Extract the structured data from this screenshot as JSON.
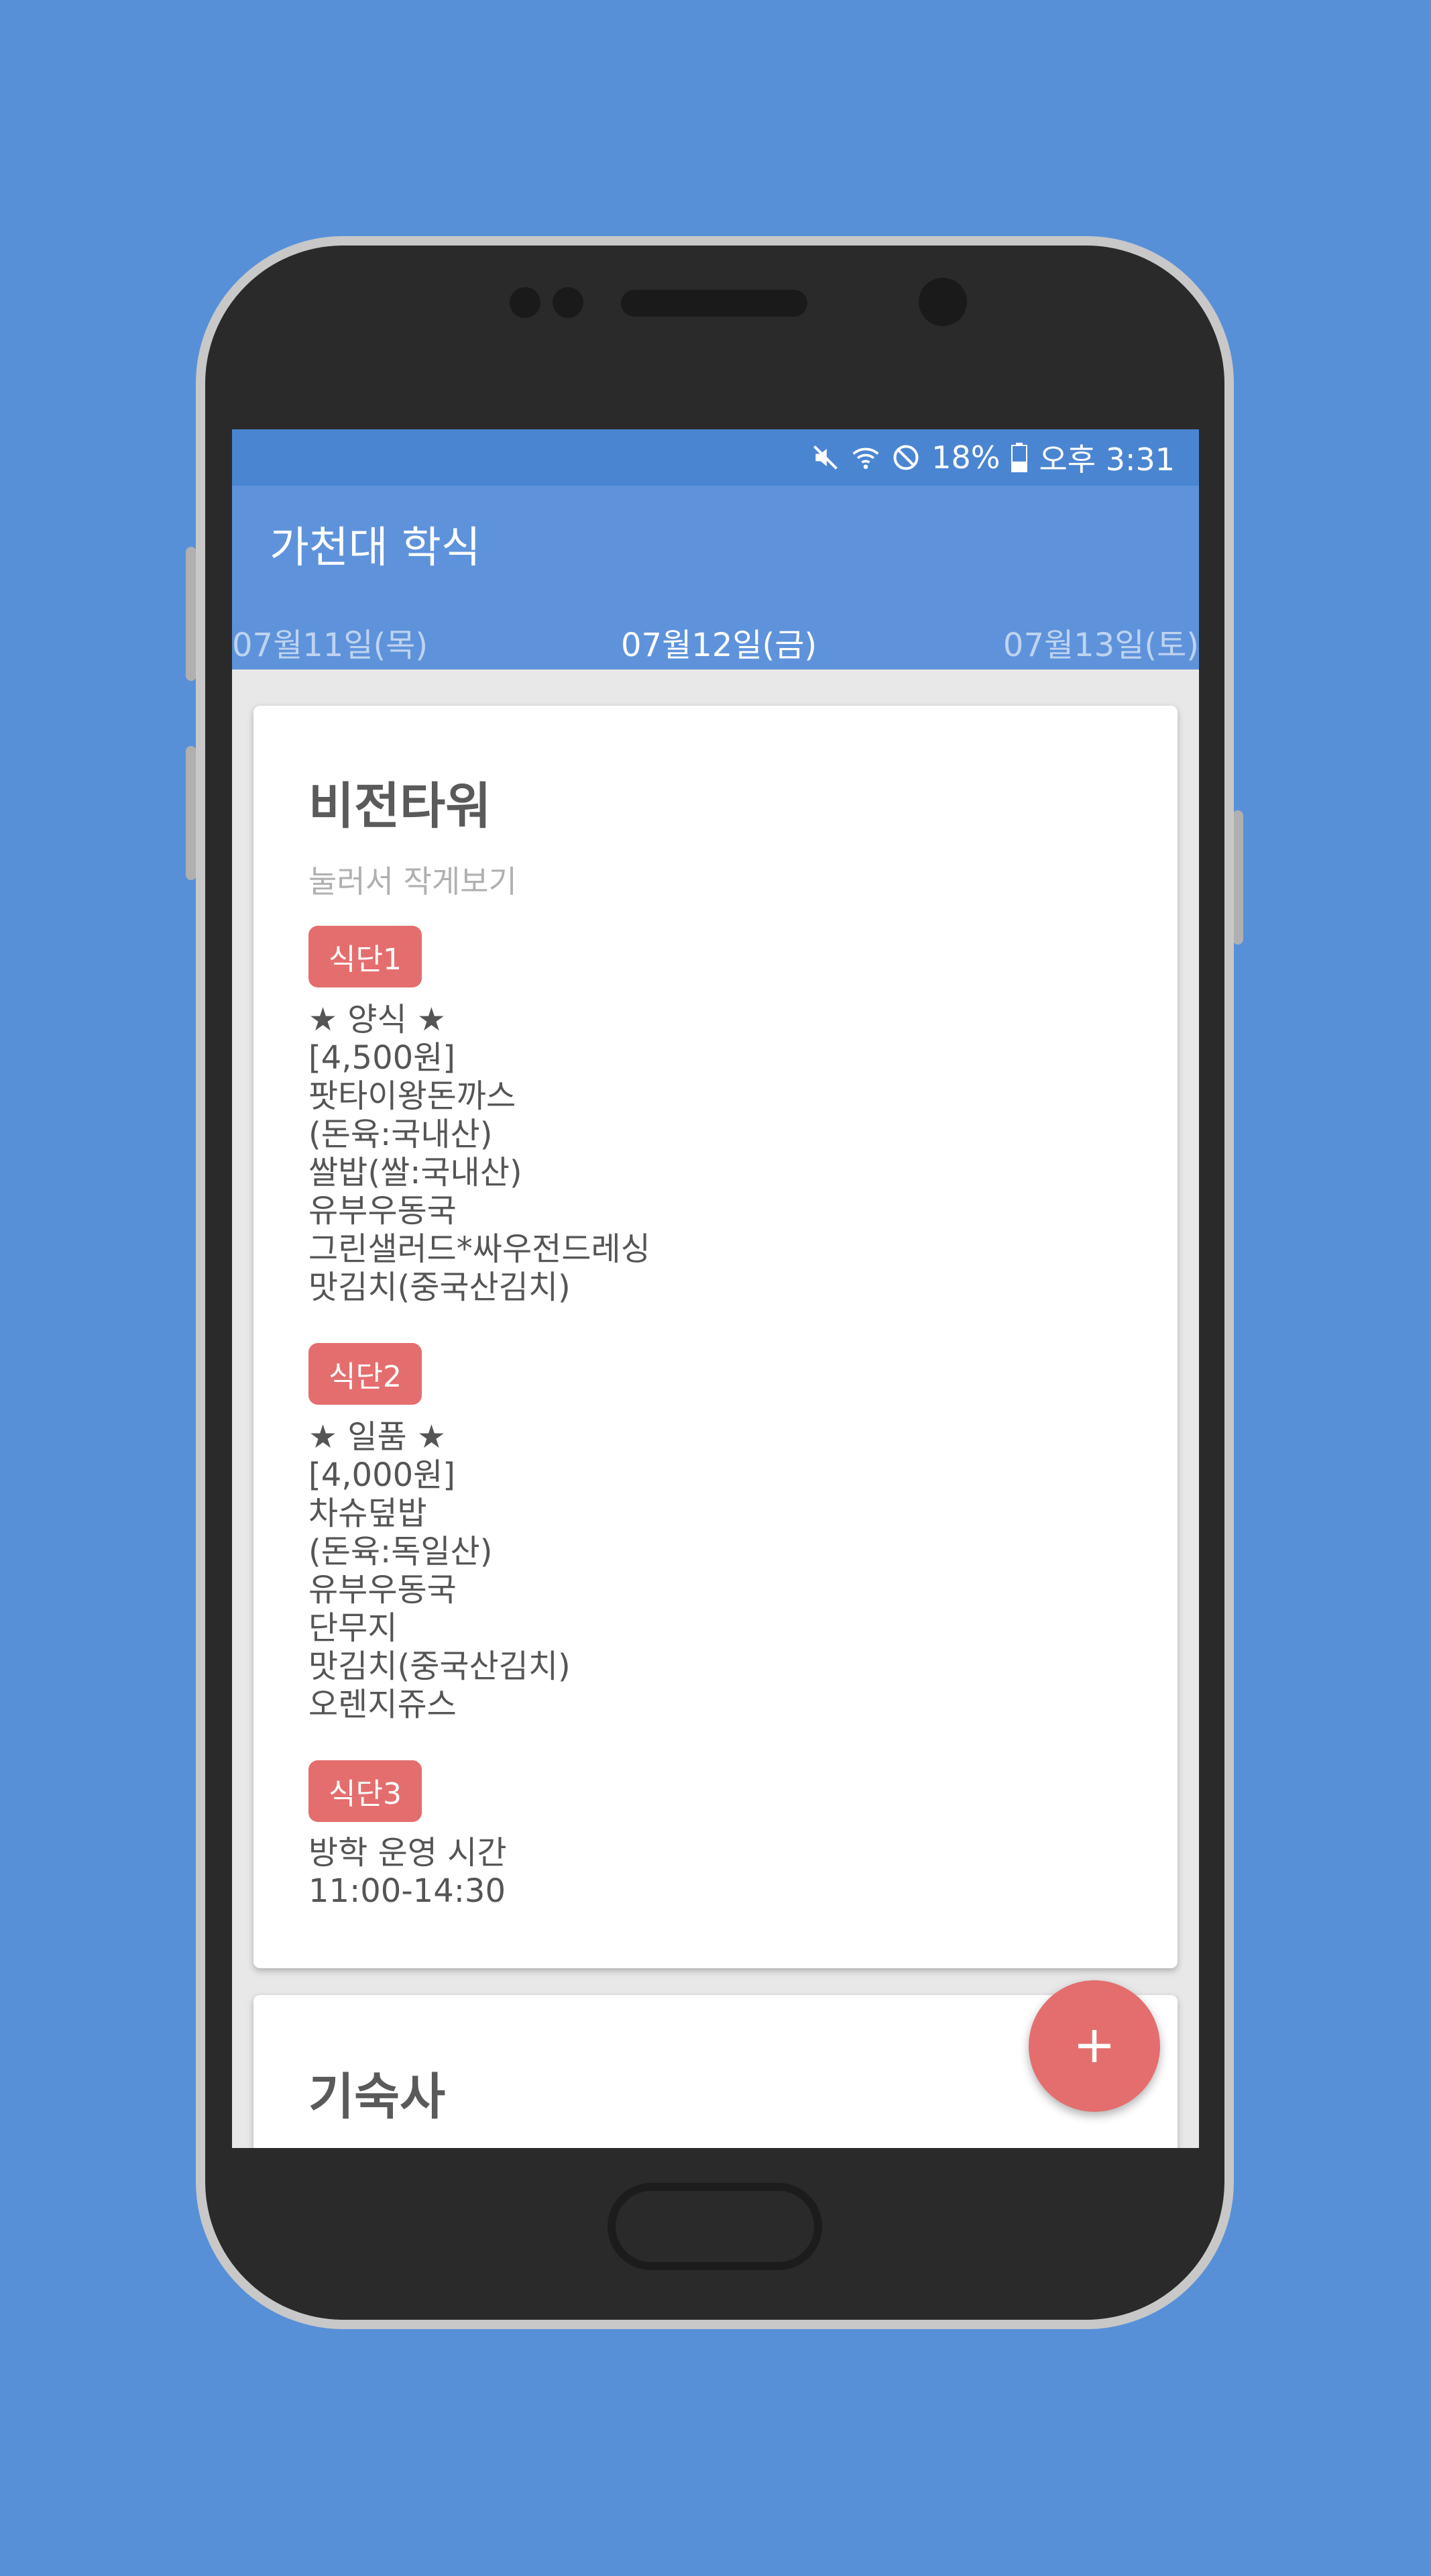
{
  "status": {
    "battery_pct": "18%",
    "time": "오후 3:31",
    "icons": [
      "mute-icon",
      "wifi-icon",
      "do-not-disturb-icon",
      "battery-icon"
    ]
  },
  "app": {
    "title": "가천대 학식"
  },
  "dates": {
    "prev": "07월11일(목)",
    "current": "07월12일(금)",
    "next": "07월13일(토)"
  },
  "cards": [
    {
      "title": "비전타워",
      "hint": "눌러서 작게보기",
      "menus": [
        {
          "badge": "식단1",
          "lines": [
            "★ 양식 ★",
            "[4,500원]",
            "팟타이왕돈까스",
            "(돈육:국내산)",
            "쌀밥(쌀:국내산)",
            "유부우동국",
            "그린샐러드*싸우전드레싱",
            "맛김치(중국산김치)"
          ]
        },
        {
          "badge": "식단2",
          "lines": [
            "★ 일품 ★",
            "[4,000원]",
            "차슈덮밥",
            "(돈육:독일산)",
            "유부우동국",
            "단무지",
            "맛김치(중국산김치)",
            "오렌지쥬스"
          ]
        },
        {
          "badge": "식단3",
          "lines": [
            "방학 운영 시간",
            "11:00-14:30"
          ]
        }
      ]
    },
    {
      "title": "기숙사"
    }
  ],
  "fab": {
    "icon": "plus-icon"
  },
  "colors": {
    "background": "#5890D8",
    "appbar": "#5E93DB",
    "statusbar": "#4A85D2",
    "accent": "#E46E6E"
  }
}
